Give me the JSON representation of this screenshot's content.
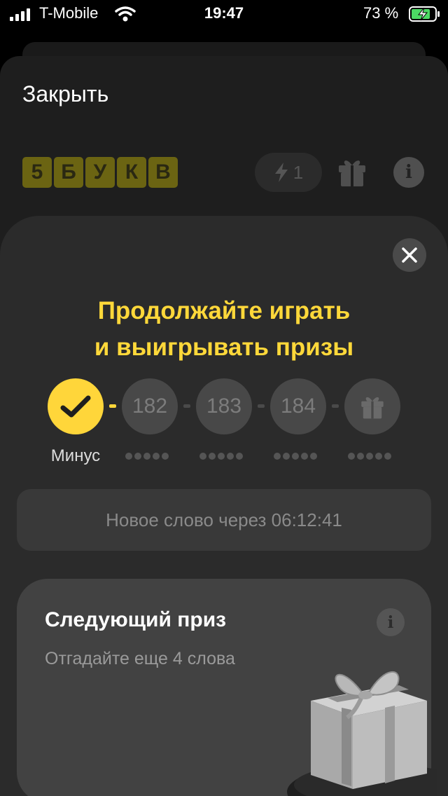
{
  "status_bar": {
    "carrier": "T-Mobile",
    "time": "19:47",
    "battery_percent": "73 %"
  },
  "header": {
    "close_label": "Закрыть",
    "logo_letters": [
      "5",
      "Б",
      "У",
      "К",
      "В"
    ],
    "energy_count": "1",
    "icons": [
      "lightning-icon",
      "gift-icon",
      "info-icon"
    ]
  },
  "dialog": {
    "headline_line1": "Продолжайте играть",
    "headline_line2": "и выигрывать призы",
    "steps": [
      {
        "kind": "done",
        "label": "Минус"
      },
      {
        "kind": "number",
        "label": "182"
      },
      {
        "kind": "number",
        "label": "183"
      },
      {
        "kind": "number",
        "label": "184"
      },
      {
        "kind": "gift",
        "label": ""
      }
    ],
    "timer_text": "Новое слово через 06:12:41"
  },
  "next_prize": {
    "title": "Следующий приз",
    "subtitle": "Отгадайте еще 4 слова"
  },
  "colors": {
    "accent": "#ffd63a",
    "background": "#1e1e1e",
    "panel": "#2b2b2b",
    "card": "#424242"
  }
}
